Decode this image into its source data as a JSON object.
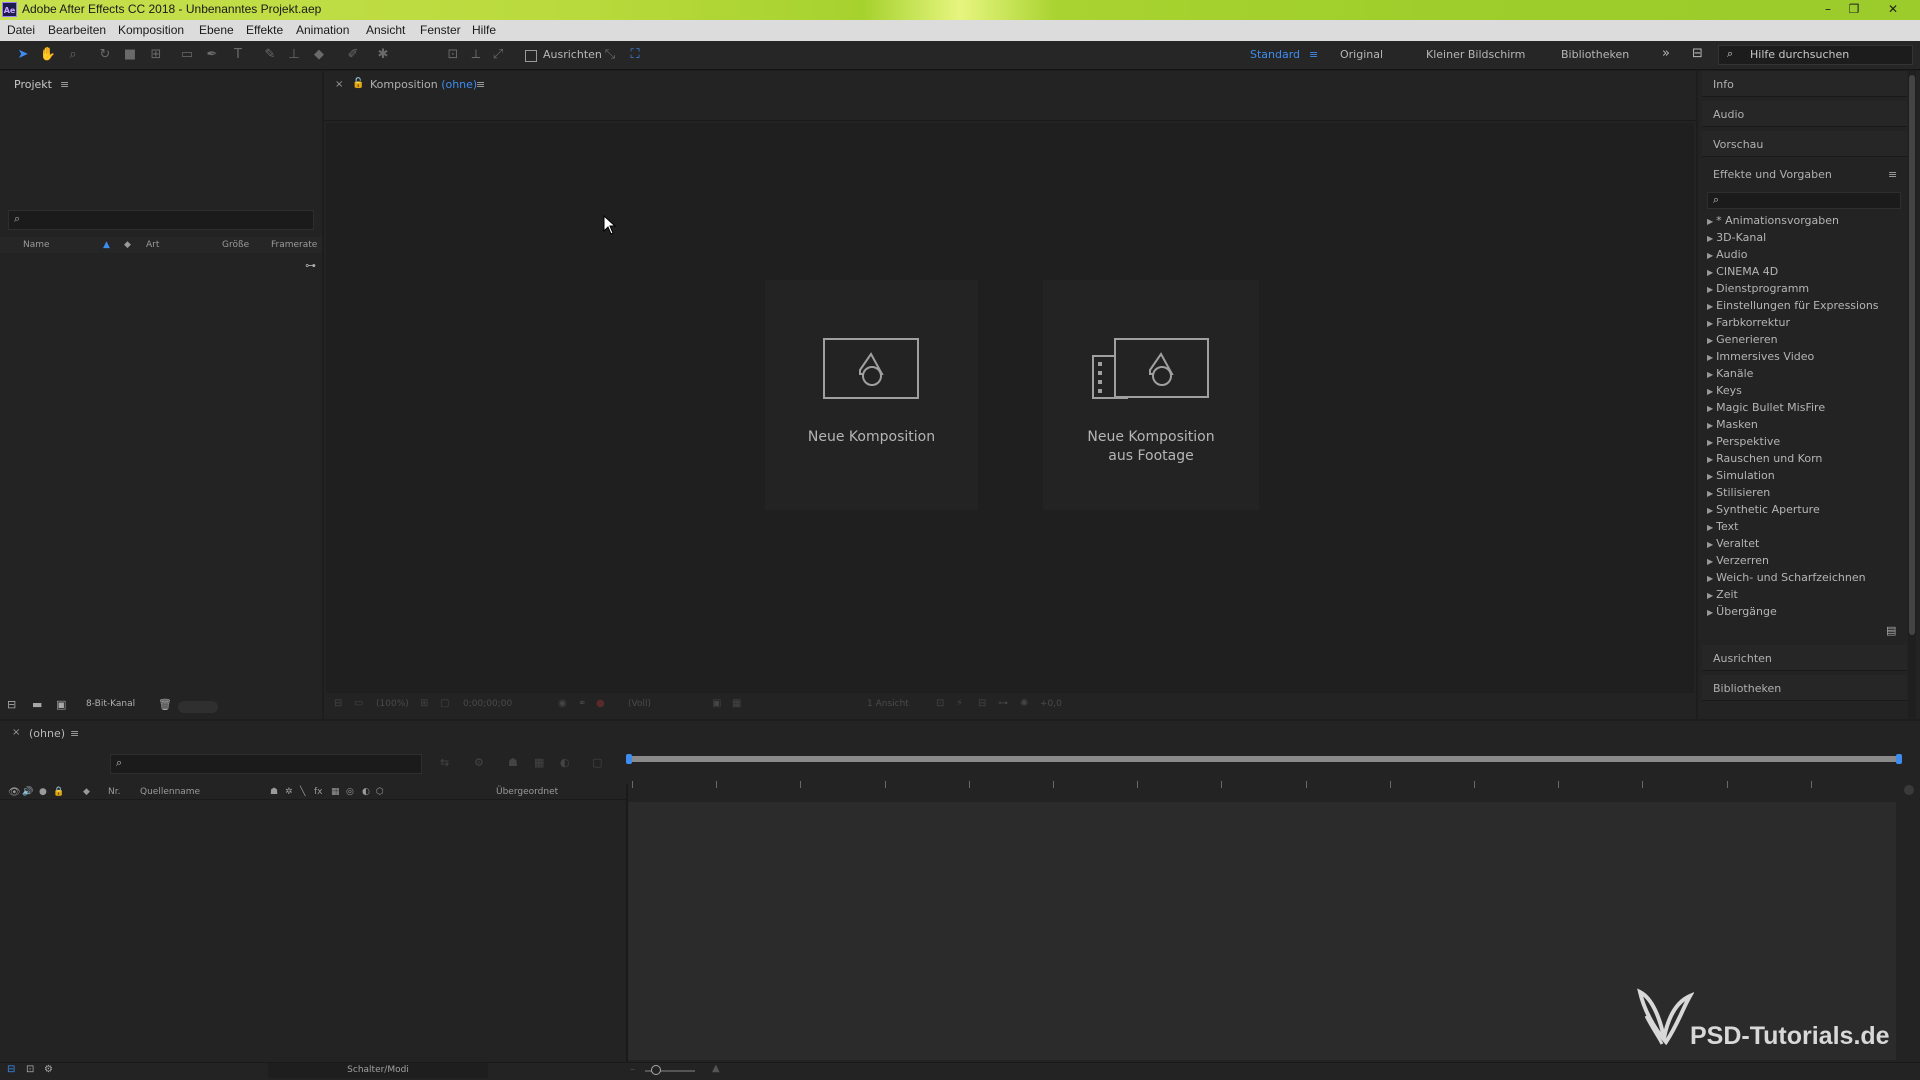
{
  "window": {
    "app_icon": "Ae",
    "title": "Adobe After Effects CC 2018 - Unbenanntes Projekt.aep"
  },
  "menu": [
    "Datei",
    "Bearbeiten",
    "Komposition",
    "Ebene",
    "Effekte",
    "Animation",
    "Ansicht",
    "Fenster",
    "Hilfe"
  ],
  "toolbar": {
    "snap_label": "Ausrichten",
    "workspaces": [
      "Standard",
      "Original",
      "Kleiner Bildschirm",
      "Bibliotheken"
    ],
    "help_placeholder": "Hilfe durchsuchen"
  },
  "project": {
    "tab": "Projekt",
    "columns": [
      "Name",
      "Art",
      "Größe",
      "Framerate"
    ],
    "bit_depth": "8-Bit-Kanal"
  },
  "composition": {
    "tab_label": "Komposition",
    "tab_state": "(ohne)",
    "new_comp": "Neue Komposition",
    "new_comp_footage_line1": "Neue Komposition",
    "new_comp_footage_line2": "aus Footage",
    "footer": {
      "zoom": "(100%)",
      "timecode": "0;00;00;00",
      "resolution": "(Voll)",
      "view": "1 Ansicht",
      "exposure": "+0,0"
    }
  },
  "right_panel": {
    "sections": [
      "Info",
      "Audio",
      "Vorschau"
    ],
    "effects_title": "Effekte und Vorgaben",
    "effects": [
      "* Animationsvorgaben",
      "3D-Kanal",
      "Audio",
      "CINEMA 4D",
      "Dienstprogramm",
      "Einstellungen für Expressions",
      "Farbkorrektur",
      "Generieren",
      "Immersives Video",
      "Kanäle",
      "Keys",
      "Magic Bullet MisFire",
      "Masken",
      "Perspektive",
      "Rauschen und Korn",
      "Simulation",
      "Stilisieren",
      "Synthetic Aperture",
      "Text",
      "Veraltet",
      "Verzerren",
      "Weich- und Scharfzeichnen",
      "Zeit",
      "Übergänge"
    ],
    "bottom_sections": [
      "Ausrichten",
      "Bibliotheken"
    ]
  },
  "timeline": {
    "tab": "(ohne)",
    "columns": {
      "nr": "Nr.",
      "source": "Quellenname",
      "parent": "Übergeordnet"
    },
    "mode_toggle": "Schalter/Modi"
  },
  "watermark": "PSD-Tutorials.de"
}
